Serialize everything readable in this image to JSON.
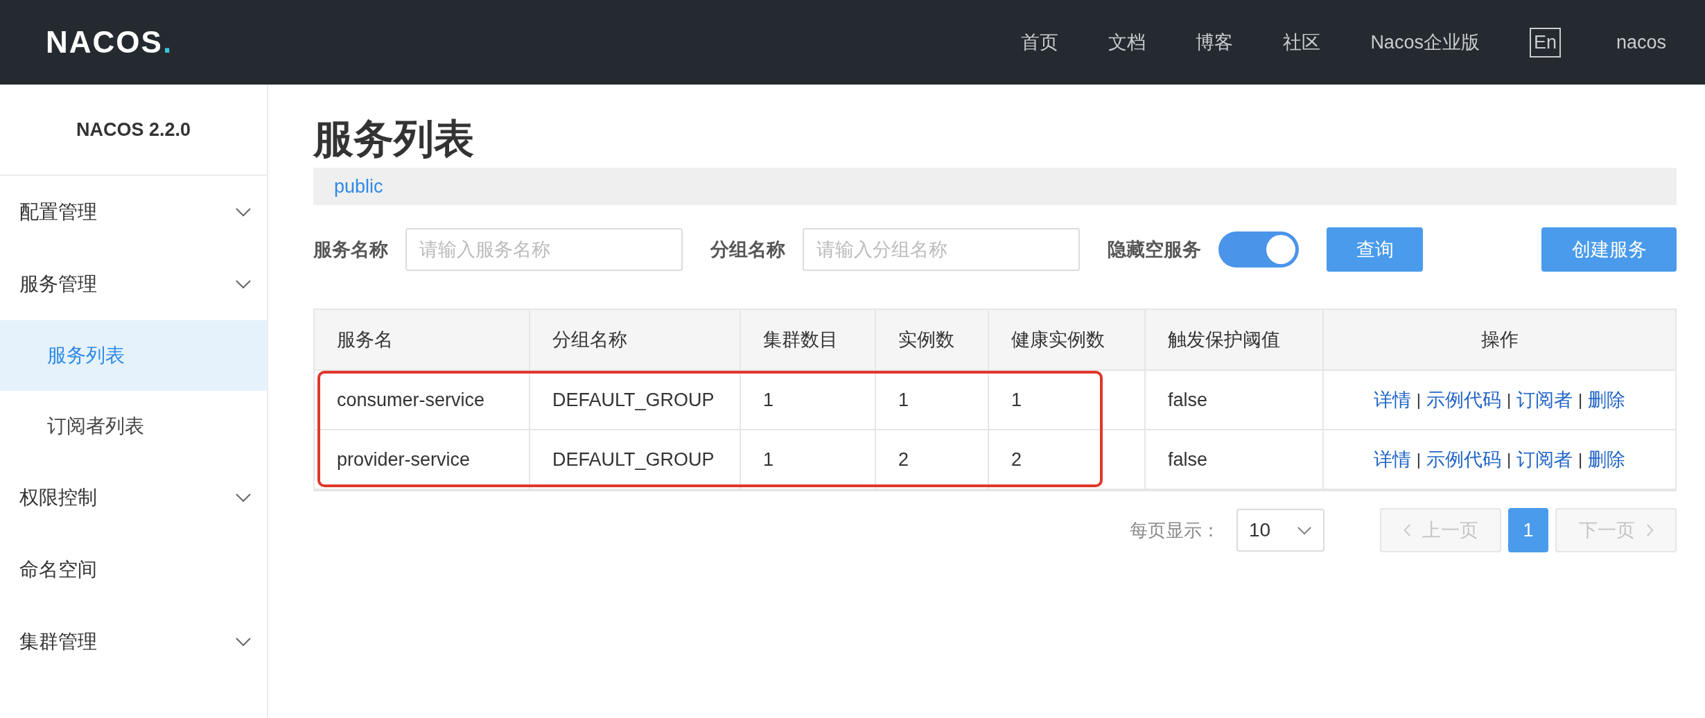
{
  "header": {
    "logo": "NACOS.",
    "nav": [
      {
        "label": "首页"
      },
      {
        "label": "文档"
      },
      {
        "label": "博客"
      },
      {
        "label": "社区"
      },
      {
        "label": "Nacos企业版"
      }
    ],
    "language": "En",
    "user": "nacos"
  },
  "sidebar": {
    "version": "NACOS 2.2.0",
    "items": [
      {
        "kind": "group",
        "label": "配置管理"
      },
      {
        "kind": "group",
        "label": "服务管理",
        "children": [
          {
            "label": "服务列表",
            "selected": true
          },
          {
            "label": "订阅者列表",
            "selected": false
          }
        ]
      },
      {
        "kind": "group",
        "label": "权限控制"
      },
      {
        "kind": "link",
        "label": "命名空间"
      },
      {
        "kind": "group",
        "label": "集群管理"
      }
    ]
  },
  "page": {
    "title": "服务列表",
    "namespace": "public"
  },
  "filters": {
    "service_label": "服务名称",
    "service_placeholder": "请输入服务名称",
    "group_label": "分组名称",
    "group_placeholder": "请输入分组名称",
    "hide_empty_label": "隐藏空服务",
    "hide_empty_on": true,
    "query_button": "查询",
    "create_button": "创建服务"
  },
  "table": {
    "columns": [
      "服务名",
      "分组名称",
      "集群数目",
      "实例数",
      "健康实例数",
      "触发保护阈值",
      "操作"
    ],
    "rows": [
      {
        "cells": [
          "consumer-service",
          "DEFAULT_GROUP",
          "1",
          "1",
          "1",
          "false"
        ],
        "actions": [
          {
            "label": "详情"
          },
          {
            "separator": "|",
            "label": "示例代码"
          },
          {
            "separator": "|",
            "label": "订阅者"
          },
          {
            "separator": "|",
            "label": "删除"
          }
        ]
      },
      {
        "cells": [
          "provider-service",
          "DEFAULT_GROUP",
          "1",
          "2",
          "2",
          "false"
        ],
        "actions": [
          {
            "label": "详情"
          },
          {
            "separator": "|",
            "label": "示例代码"
          },
          {
            "separator": "|",
            "label": "订阅者"
          },
          {
            "separator": "|",
            "label": "删除"
          }
        ]
      }
    ],
    "highlighted_rows": true
  },
  "pagination": {
    "page_size_label": "每页显示：",
    "page_size": "10",
    "prev": {
      "label": "上一页",
      "disabled": true
    },
    "pages": [
      {
        "label": "1",
        "selected": true
      }
    ],
    "next": {
      "label": "下一页",
      "disabled": true
    }
  }
}
